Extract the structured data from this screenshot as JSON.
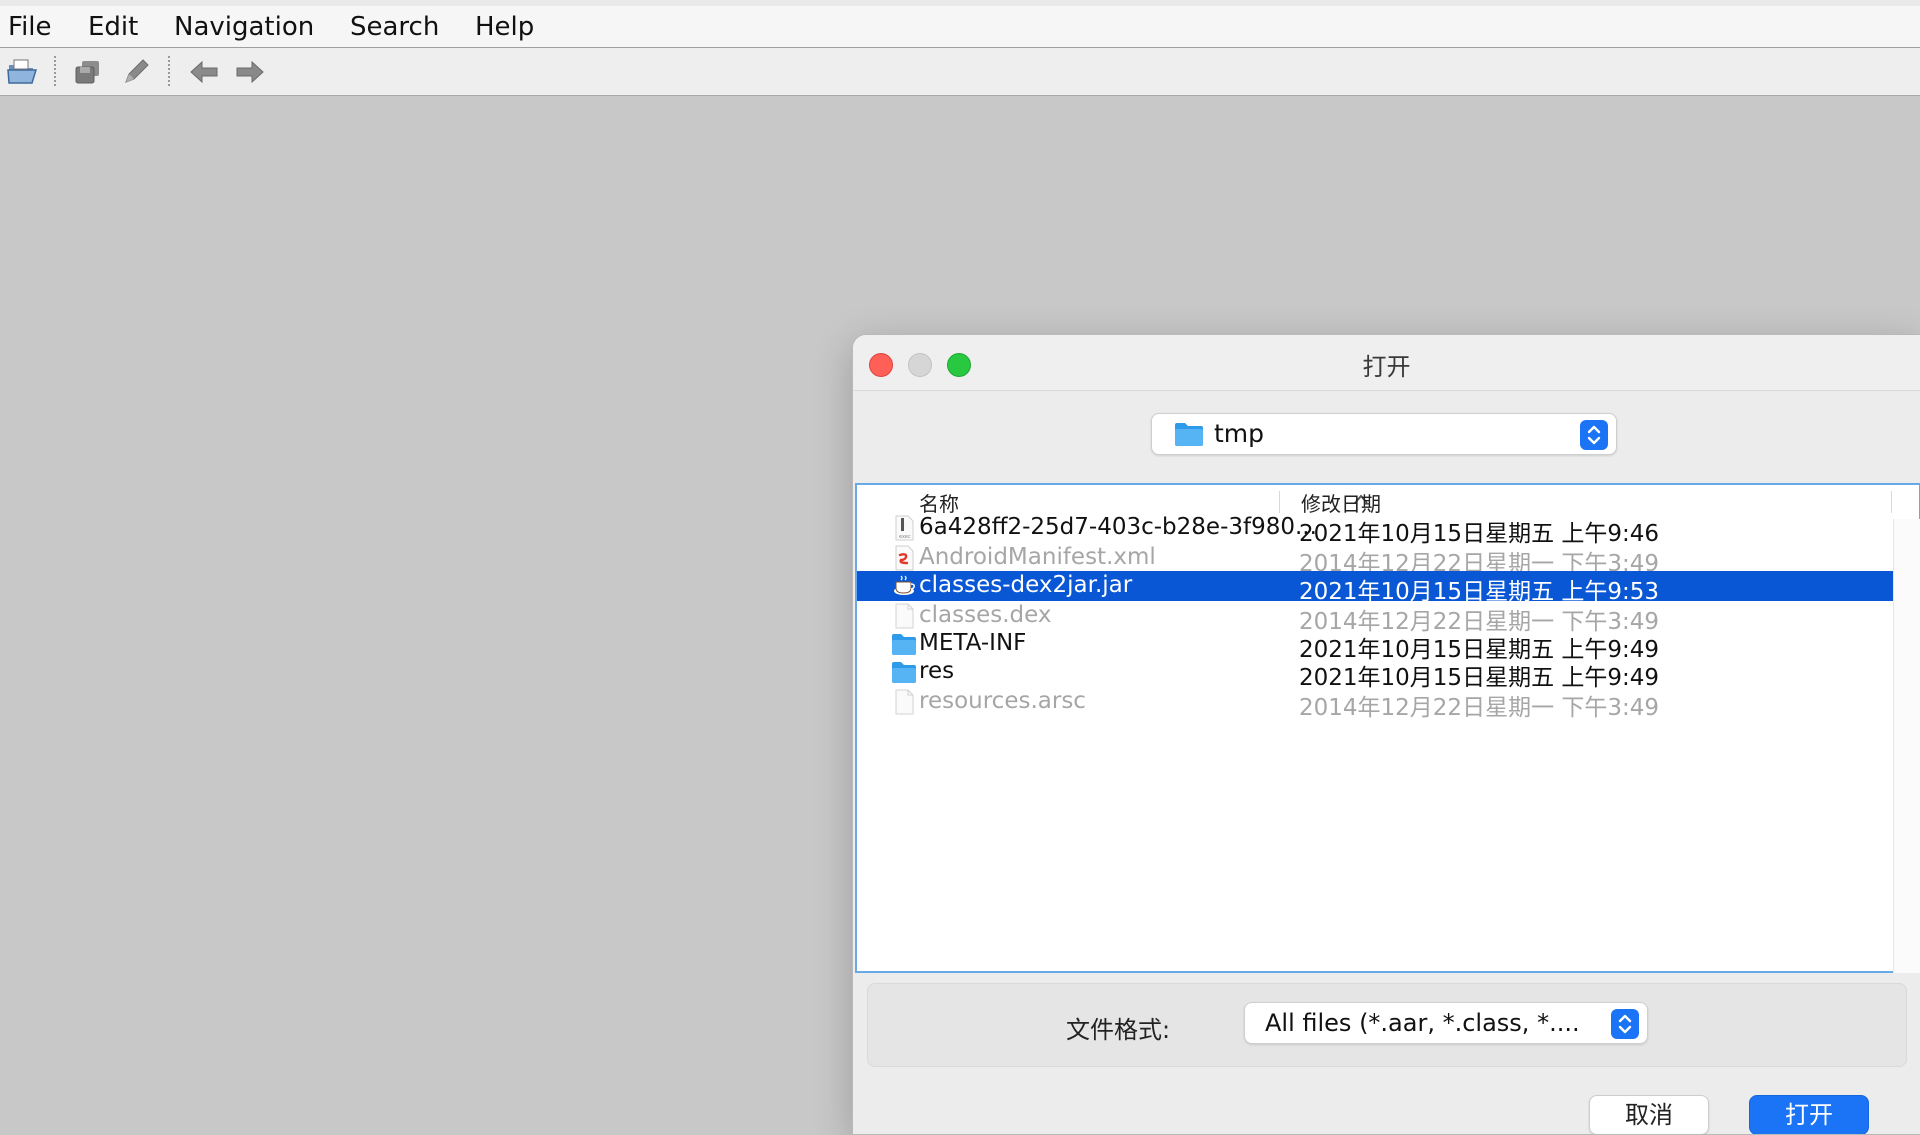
{
  "menu": [
    "File",
    "Edit",
    "Navigation",
    "Search",
    "Help"
  ],
  "toolbar": {
    "icons": [
      "open-file-icon",
      "save-all-icon",
      "edit-pencil-icon",
      "back-arrow-icon",
      "forward-arrow-icon"
    ]
  },
  "dialog": {
    "title": "打开",
    "folder": "tmp",
    "columns": {
      "name": "名称",
      "date": "修改日期"
    },
    "files": [
      {
        "name": "6a428ff2-25d7-403c-b28e-3f980...",
        "date": "2021年10月15日星期五 上午9:46",
        "icon": "file-icon",
        "state": "normal"
      },
      {
        "name": "AndroidManifest.xml",
        "date": "2014年12月22日星期一 下午3:49",
        "icon": "xml-file-icon",
        "state": "disabled"
      },
      {
        "name": "classes-dex2jar.jar",
        "date": "2021年10月15日星期五 上午9:53",
        "icon": "java-jar-icon",
        "state": "selected"
      },
      {
        "name": "classes.dex",
        "date": "2014年12月22日星期一 下午3:49",
        "icon": "blank-file-icon",
        "state": "disabled"
      },
      {
        "name": "META-INF",
        "date": "2021年10月15日星期五 上午9:49",
        "icon": "folder-icon",
        "state": "normal"
      },
      {
        "name": "res",
        "date": "2021年10月15日星期五 上午9:49",
        "icon": "folder-icon",
        "state": "normal"
      },
      {
        "name": "resources.arsc",
        "date": "2014年12月22日星期一 下午3:49",
        "icon": "blank-file-icon",
        "state": "disabled"
      }
    ],
    "format_label": "文件格式:",
    "format_value": "All files (*.aar, *.class, *....",
    "cancel_label": "取消",
    "open_label": "打开"
  },
  "colors": {
    "accent": "#1b74f5",
    "selection": "#0a57d6",
    "close": "#fe5f57",
    "zoom": "#28c840"
  }
}
